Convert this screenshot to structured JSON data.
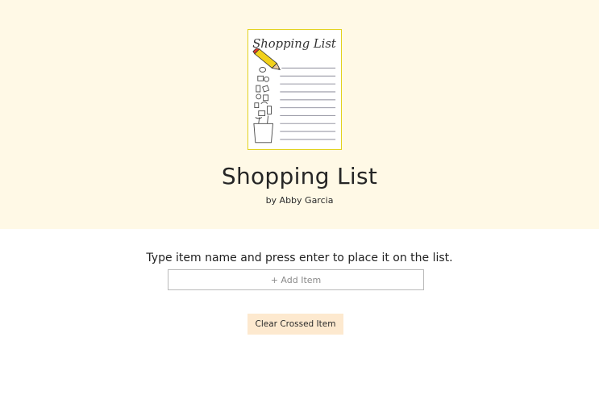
{
  "header": {
    "logo_text": "Shopping List",
    "title": "Shopping List",
    "byline": "by Abby Garcia"
  },
  "main": {
    "instructions": "Type item name and press enter to place it on the list.",
    "add_item": {
      "placeholder": "+ Add Item",
      "value": ""
    },
    "clear_button_label": "Clear Crossed Item"
  },
  "colors": {
    "hero_background": "#fff9e6",
    "logo_border": "#e2d21d",
    "button_background": "#fde9cf",
    "input_border": "#b9b9b9"
  },
  "icons": {
    "logo": "shopping-list-notepad-icon",
    "pencil": "pencil-icon"
  }
}
